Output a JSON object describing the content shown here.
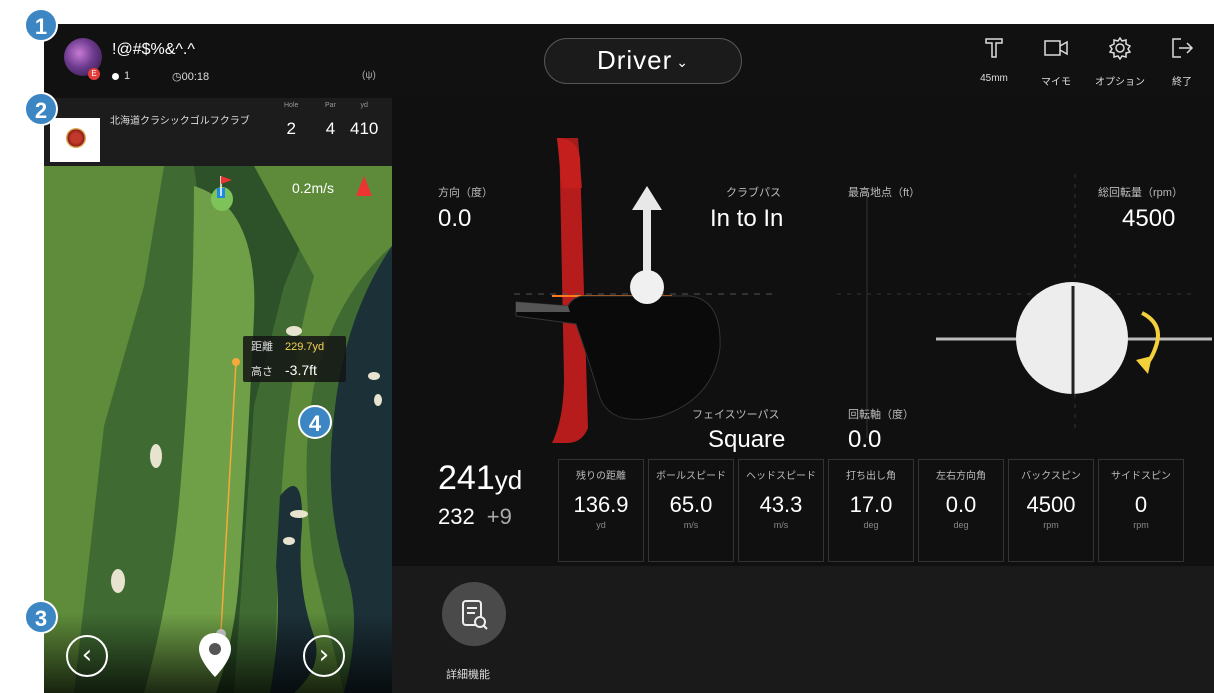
{
  "top_bar": {
    "player_name": "!@#$%&^.^",
    "avatar_badge": "E",
    "stroke_count": "1",
    "timer": "00:18",
    "signal": "(ψ)",
    "club": "Driver",
    "tools": [
      {
        "label": "45mm",
        "icon": "tee-icon"
      },
      {
        "label": "マイモ",
        "icon": "camera-icon"
      },
      {
        "label": "オプション",
        "icon": "gear-icon"
      },
      {
        "label": "終了",
        "icon": "exit-icon"
      }
    ]
  },
  "course": {
    "name": "北海道クラシックゴルフクラブ",
    "hole_header": "Hole",
    "par_header": "Par",
    "yd_header": "yd",
    "hole": "2",
    "par": "4",
    "yards": "410"
  },
  "map": {
    "wind": "0.2m/s",
    "distance_label": "距離",
    "distance_value": "229.7yd",
    "height_label": "高さ",
    "height_value": "-3.7ft"
  },
  "swing": {
    "direction_label": "方向（度）",
    "direction_value": "0.0",
    "club_path_label": "クラブパス",
    "club_path_value": "In to In",
    "face_label": "フェイスツーパス",
    "face_value": "Square"
  },
  "ball": {
    "apex_label": "最高地点（ft）",
    "total_spin_label": "総回転量（rpm）",
    "total_spin_value": "4500",
    "spin_axis_label": "回転軸（度）",
    "spin_axis_value": "0.0"
  },
  "result": {
    "total": "241",
    "total_unit": "yd",
    "carry": "232",
    "roll": "+9"
  },
  "stats": [
    {
      "title": "残りの距離",
      "value": "136.9",
      "unit": "yd"
    },
    {
      "title": "ボールスピード",
      "value": "65.0",
      "unit": "m/s"
    },
    {
      "title": "ヘッドスピード",
      "value": "43.3",
      "unit": "m/s"
    },
    {
      "title": "打ち出し角",
      "value": "17.0",
      "unit": "deg"
    },
    {
      "title": "左右方向角",
      "value": "0.0",
      "unit": "deg"
    },
    {
      "title": "バックスピン",
      "value": "4500",
      "unit": "rpm"
    },
    {
      "title": "サイドスピン",
      "value": "0",
      "unit": "rpm"
    }
  ],
  "bottom": {
    "detail_label": "詳細機能"
  },
  "markers": [
    "1",
    "2",
    "3",
    "4"
  ],
  "colors": {
    "accent_red": "#c8201e",
    "distance_yellow": "#f6d35a",
    "marker_blue": "#3d86c4",
    "fairway_green": "#4d7a3a"
  }
}
